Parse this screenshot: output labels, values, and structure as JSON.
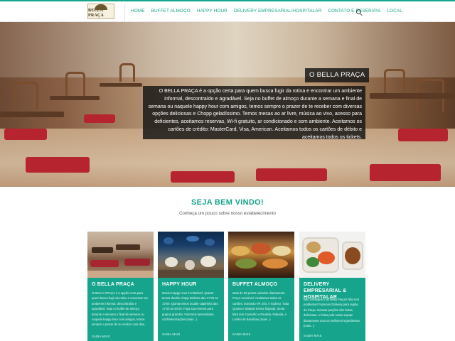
{
  "header": {
    "logo_text": "BELLA PRAÇA",
    "nav": [
      "HOME",
      "BUFFET ALMOÇO",
      "HAPPY HOUR",
      "DELIVERY EMPRESARIAL/HOSPITALAR",
      "CONTATO E RESERVAS",
      "LOCAL"
    ],
    "search_icon": "search-icon"
  },
  "hero": {
    "title": "O BELLA PRAÇA",
    "text": "O BELLA PRAÇA é a opção certa para quem busca fugir da rotina e encontrar um ambiente informal, descontraído e agradável. Seja no buffet de almoço durante a semana e final de semana ou naquele happy hour com amigos, temos sempre o prazer de te receber com diversas opções deliciosas e Chopp geladíssimo. Temos mesas ao ar livre, música ao vivo, acesso para deficientes, aceitamos reservas, Wi-fi gratuito, ar condicionado e som ambiente. Aceitamos os cartões de crédito: MasterCard, Visa, American. Aceitamos todos os cartões de débito e aceitamos todos os tickets."
  },
  "welcome": {
    "title": "SEJA BEM VINDO!",
    "subtitle": "Conheça um pouco sobre nosso estabelecimento"
  },
  "cards": [
    {
      "title": "O BELLA PRAÇA",
      "text": "O BELLA PRAÇA é a opção certa para quem busca fugir da rotina e encontrar um ambiente informal, descontraído e agradável. Seja no buffet de almoço durante a semana e final de semana ou naquele happy hour com amigos, temos sempre o prazer de te receber com dive...",
      "more": "SAIBA MAIS"
    },
    {
      "title": "HAPPY HOUR",
      "text": "Nosso Happy Hour é Imbatível. Quarta temos double chopp Brahma das 17:00 as 19:00. Quinta temos double caipirinha das 17:00 as 20:00. Faça sua reserva para grupos grandes. Fazemos aniversários, confraternizações (mais...)",
      "more": "SAIBA MAIS"
    },
    {
      "title": "BUFFET ALMOÇO",
      "text": "Mais de 50 pratos variados diariamente. Preço Acessível. Aceitamos todos os cartões, incluindo VR, Elo, e Sodexo. Toda Quarta e Sábado temos feijoada. Sexta feira tem Camarão a Paulista, Rabada, e Lombo de Bacalhau (mais...)",
      "more": "SAIBA MAIS"
    },
    {
      "title": "DELIVERY EMPRESARIAL & HOSPITALAR",
      "text": "Não consegue ir ao Bella Praça? Não tem problema!! Fazemos Delivery para região da Praça. Nossas porções são fartas, deliciosas, e feitas pela nossa equipe diariamente com os melhores ingredientes. (mais...)",
      "more": "SAIBA MAIS"
    }
  ]
}
